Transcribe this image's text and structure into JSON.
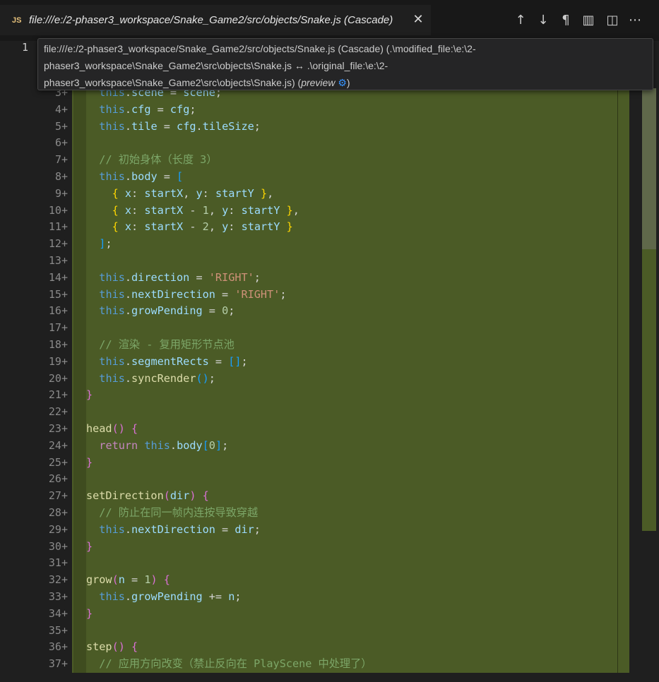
{
  "tab": {
    "lang_badge": "JS",
    "title": "file:///e:/2-phaser3_workspace/Snake_Game2/src/objects/Snake.js (Cascade)",
    "close_glyph": "✕"
  },
  "toolbar": {
    "icons": [
      "arrow-up-icon",
      "arrow-down-icon",
      "pilcrow-icon",
      "map-icon",
      "split-editor-icon",
      "more-icon"
    ],
    "glyphs": [
      "↑",
      "↓",
      "¶",
      "▥",
      "◫",
      "⋯"
    ]
  },
  "editor": {
    "first_line_number": "1",
    "line_numbers": [
      "3+",
      "4+",
      "5+",
      "6+",
      "7+",
      "8+",
      "9+",
      "10+",
      "11+",
      "12+",
      "13+",
      "14+",
      "15+",
      "16+",
      "17+",
      "18+",
      "19+",
      "20+",
      "21+",
      "22+",
      "23+",
      "24+",
      "25+",
      "26+",
      "27+",
      "28+",
      "29+",
      "30+",
      "31+",
      "32+",
      "33+",
      "34+",
      "35+",
      "36+",
      "37+"
    ]
  },
  "hover": {
    "line1": "file:///e:/2-phaser3_workspace/Snake_Game2/src/objects/Snake.js (Cascade) (.\\modified_file:\\e:\\2-",
    "line2": "phaser3_workspace\\Snake_Game2\\src\\objects\\Snake.js ↔ .\\original_file:\\e:\\2-",
    "line3_prefix": "phaser3_workspace\\Snake_Game2\\src\\objects\\Snake.js) (",
    "line3_preview": "preview",
    "line3_suffix": ")",
    "gear_glyph": "⚙"
  },
  "colors": {
    "added_background": "#4b5b26",
    "keyword": "#569cd6",
    "comment": "#7ca668",
    "string": "#ce9178"
  }
}
